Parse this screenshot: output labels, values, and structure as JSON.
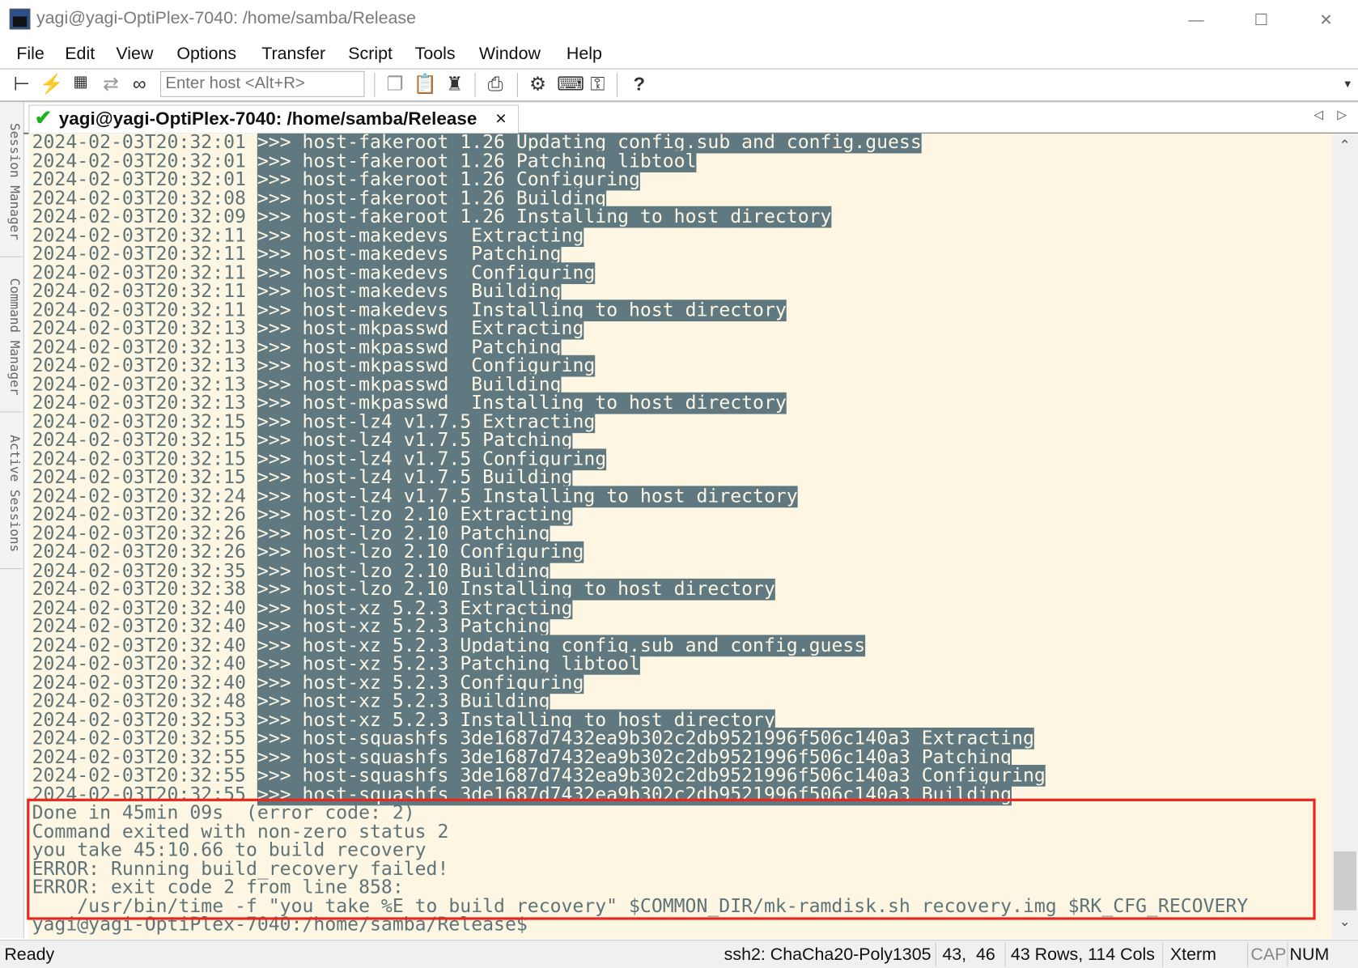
{
  "window": {
    "title": "yagi@yagi-OptiPlex-7040: /home/samba/Release"
  },
  "menu": [
    "File",
    "Edit",
    "View",
    "Options",
    "Transfer",
    "Script",
    "Tools",
    "Window",
    "Help"
  ],
  "toolbar": {
    "host_placeholder": "Enter host <Alt+R>"
  },
  "tab": {
    "label": "yagi@yagi-OptiPlex-7040: /home/samba/Release",
    "close": "×"
  },
  "sidebar": [
    "Session Manager",
    "Command Manager",
    "Active Sessions"
  ],
  "terminal": {
    "log": [
      [
        "2024-02-03T20:32:01",
        ">>> host-fakeroot 1.26 Updating config.sub and config.guess"
      ],
      [
        "2024-02-03T20:32:01",
        ">>> host-fakeroot 1.26 Patching libtool"
      ],
      [
        "2024-02-03T20:32:01",
        ">>> host-fakeroot 1.26 Configuring"
      ],
      [
        "2024-02-03T20:32:08",
        ">>> host-fakeroot 1.26 Building"
      ],
      [
        "2024-02-03T20:32:09",
        ">>> host-fakeroot 1.26 Installing to host directory"
      ],
      [
        "2024-02-03T20:32:11",
        ">>> host-makedevs  Extracting"
      ],
      [
        "2024-02-03T20:32:11",
        ">>> host-makedevs  Patching"
      ],
      [
        "2024-02-03T20:32:11",
        ">>> host-makedevs  Configuring"
      ],
      [
        "2024-02-03T20:32:11",
        ">>> host-makedevs  Building"
      ],
      [
        "2024-02-03T20:32:11",
        ">>> host-makedevs  Installing to host directory"
      ],
      [
        "2024-02-03T20:32:13",
        ">>> host-mkpasswd  Extracting"
      ],
      [
        "2024-02-03T20:32:13",
        ">>> host-mkpasswd  Patching"
      ],
      [
        "2024-02-03T20:32:13",
        ">>> host-mkpasswd  Configuring"
      ],
      [
        "2024-02-03T20:32:13",
        ">>> host-mkpasswd  Building"
      ],
      [
        "2024-02-03T20:32:13",
        ">>> host-mkpasswd  Installing to host directory"
      ],
      [
        "2024-02-03T20:32:15",
        ">>> host-lz4 v1.7.5 Extracting"
      ],
      [
        "2024-02-03T20:32:15",
        ">>> host-lz4 v1.7.5 Patching"
      ],
      [
        "2024-02-03T20:32:15",
        ">>> host-lz4 v1.7.5 Configuring"
      ],
      [
        "2024-02-03T20:32:15",
        ">>> host-lz4 v1.7.5 Building"
      ],
      [
        "2024-02-03T20:32:24",
        ">>> host-lz4 v1.7.5 Installing to host directory"
      ],
      [
        "2024-02-03T20:32:26",
        ">>> host-lzo 2.10 Extracting"
      ],
      [
        "2024-02-03T20:32:26",
        ">>> host-lzo 2.10 Patching"
      ],
      [
        "2024-02-03T20:32:26",
        ">>> host-lzo 2.10 Configuring"
      ],
      [
        "2024-02-03T20:32:35",
        ">>> host-lzo 2.10 Building"
      ],
      [
        "2024-02-03T20:32:38",
        ">>> host-lzo 2.10 Installing to host directory"
      ],
      [
        "2024-02-03T20:32:40",
        ">>> host-xz 5.2.3 Extracting"
      ],
      [
        "2024-02-03T20:32:40",
        ">>> host-xz 5.2.3 Patching"
      ],
      [
        "2024-02-03T20:32:40",
        ">>> host-xz 5.2.3 Updating config.sub and config.guess"
      ],
      [
        "2024-02-03T20:32:40",
        ">>> host-xz 5.2.3 Patching libtool"
      ],
      [
        "2024-02-03T20:32:40",
        ">>> host-xz 5.2.3 Configuring"
      ],
      [
        "2024-02-03T20:32:48",
        ">>> host-xz 5.2.3 Building"
      ],
      [
        "2024-02-03T20:32:53",
        ">>> host-xz 5.2.3 Installing to host directory"
      ],
      [
        "2024-02-03T20:32:55",
        ">>> host-squashfs 3de1687d7432ea9b302c2db9521996f506c140a3 Extracting"
      ],
      [
        "2024-02-03T20:32:55",
        ">>> host-squashfs 3de1687d7432ea9b302c2db9521996f506c140a3 Patching"
      ],
      [
        "2024-02-03T20:32:55",
        ">>> host-squashfs 3de1687d7432ea9b302c2db9521996f506c140a3 Configuring"
      ],
      [
        "2024-02-03T20:32:55",
        ">>> host-squashfs 3de1687d7432ea9b302c2db9521996f506c140a3 Building"
      ]
    ],
    "output": [
      "Done in 45min 09s  (error code: 2)",
      "Command exited with non-zero status 2",
      "you take 45:10.66 to build recovery",
      "ERROR: Running build_recovery failed!",
      "ERROR: exit code 2 from line 858:",
      "    /usr/bin/time -f \"you take %E to build recovery\" $COMMON_DIR/mk-ramdisk.sh recovery.img $RK_CFG_RECOVERY"
    ],
    "prompt": "yagi@yagi-OptiPlex-7040:/home/samba/Release$"
  },
  "status": {
    "ready": "Ready",
    "cipher": "ssh2: ChaCha20-Poly1305",
    "cursor": "43,  46",
    "size": "43 Rows, 114 Cols",
    "emulation": "Xterm",
    "cap": "CAP",
    "num": "NUM"
  },
  "colors": {
    "terminal_bg": "#fdf6e3",
    "terminal_fg": "#5f7479",
    "highlight_bg": "#607880",
    "annotation_box": "#e8281e",
    "connected_check": "#1db31d"
  }
}
